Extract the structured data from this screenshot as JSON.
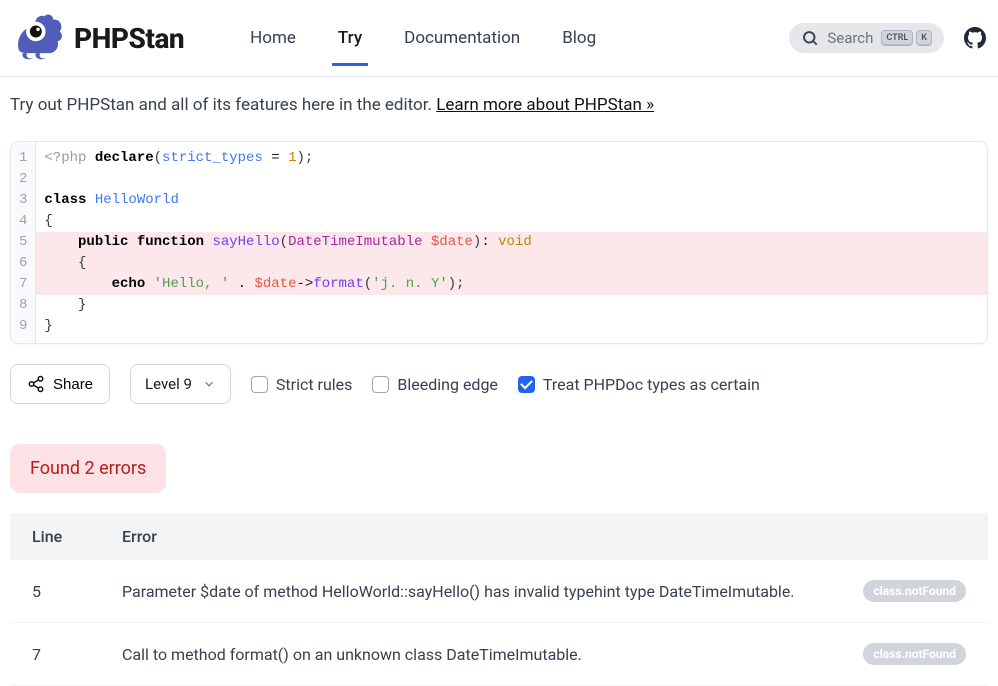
{
  "header": {
    "brand": "PHPStan",
    "nav": [
      "Home",
      "Try",
      "Documentation",
      "Blog"
    ],
    "nav_active_index": 1,
    "search_placeholder": "Search",
    "kbd1": "CTRL",
    "kbd2": "K"
  },
  "intro": {
    "text": "Try out PHPStan and all of its features here in the editor. ",
    "link_text": "Learn more about PHPStan »"
  },
  "code": {
    "lines": [
      {
        "n": 1,
        "err": false,
        "tokens": [
          {
            "t": "<?php ",
            "c": "tok-php"
          },
          {
            "t": "declare",
            "c": "tok-key"
          },
          {
            "t": "(",
            "c": "tok-paren"
          },
          {
            "t": "strict_types",
            "c": "tok-cls"
          },
          {
            "t": " = ",
            "c": ""
          },
          {
            "t": "1",
            "c": "tok-void"
          },
          {
            "t": ");",
            "c": "tok-paren"
          }
        ]
      },
      {
        "n": 2,
        "err": false,
        "tokens": []
      },
      {
        "n": 3,
        "err": false,
        "tokens": [
          {
            "t": "class ",
            "c": "tok-key"
          },
          {
            "t": "HelloWorld",
            "c": "tok-cls"
          }
        ]
      },
      {
        "n": 4,
        "err": false,
        "tokens": [
          {
            "t": "{",
            "c": "tok-paren"
          }
        ]
      },
      {
        "n": 5,
        "err": true,
        "tokens": [
          {
            "t": "    ",
            "c": ""
          },
          {
            "t": "public function",
            "c": "tok-key"
          },
          {
            "t": " ",
            "c": ""
          },
          {
            "t": "sayHello",
            "c": "tok-fn"
          },
          {
            "t": "(",
            "c": "tok-paren"
          },
          {
            "t": "DateTimeImutable",
            "c": "tok-type"
          },
          {
            "t": " ",
            "c": ""
          },
          {
            "t": "$date",
            "c": "tok-var"
          },
          {
            "t": ")",
            "c": "tok-paren"
          },
          {
            "t": ": ",
            "c": ""
          },
          {
            "t": "void",
            "c": "tok-void"
          }
        ]
      },
      {
        "n": 6,
        "err": true,
        "tokens": [
          {
            "t": "    {",
            "c": "tok-paren"
          }
        ]
      },
      {
        "n": 7,
        "err": true,
        "tokens": [
          {
            "t": "        ",
            "c": ""
          },
          {
            "t": "echo",
            "c": "tok-key"
          },
          {
            "t": " ",
            "c": ""
          },
          {
            "t": "'Hello, '",
            "c": "tok-str"
          },
          {
            "t": " . ",
            "c": ""
          },
          {
            "t": "$date",
            "c": "tok-var"
          },
          {
            "t": "->",
            "c": ""
          },
          {
            "t": "format",
            "c": "tok-fn"
          },
          {
            "t": "(",
            "c": "tok-paren"
          },
          {
            "t": "'j. n. Y'",
            "c": "tok-str"
          },
          {
            "t": ");",
            "c": "tok-paren"
          }
        ]
      },
      {
        "n": 8,
        "err": false,
        "tokens": [
          {
            "t": "    }",
            "c": "tok-paren"
          }
        ]
      },
      {
        "n": 9,
        "err": false,
        "tokens": [
          {
            "t": "}",
            "c": "tok-paren"
          }
        ]
      }
    ]
  },
  "controls": {
    "share_label": "Share",
    "level_label": "Level 9",
    "checks": [
      {
        "label": "Strict rules",
        "checked": false
      },
      {
        "label": "Bleeding edge",
        "checked": false
      },
      {
        "label": "Treat PHPDoc types as certain",
        "checked": true
      }
    ]
  },
  "results": {
    "summary": "Found 2 errors",
    "columns": {
      "line": "Line",
      "error": "Error"
    },
    "rows": [
      {
        "line": "5",
        "msg": "Parameter $date of method HelloWorld::sayHello() has invalid typehint type DateTimeImutable.",
        "badge": "class.notFound"
      },
      {
        "line": "7",
        "msg": "Call to method format() on an unknown class DateTimeImutable.",
        "badge": "class.notFound"
      }
    ]
  }
}
